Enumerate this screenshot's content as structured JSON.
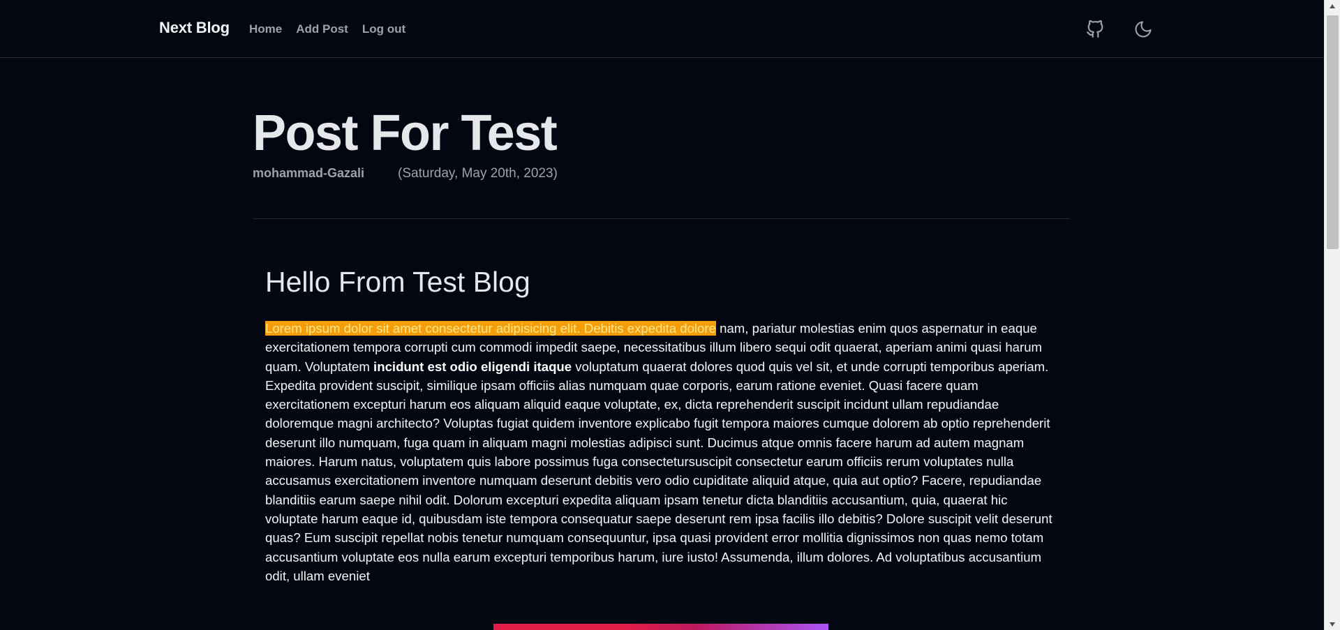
{
  "header": {
    "brand": "Next Blog",
    "nav": [
      {
        "label": "Home"
      },
      {
        "label": "Add Post"
      },
      {
        "label": "Log out"
      }
    ],
    "icons": [
      "github-icon",
      "moon-icon"
    ]
  },
  "post": {
    "title": "Post For Test",
    "author": "mohammad-Gazali",
    "date": "(Saturday, May 20th, 2023)",
    "heading": "Hello From Test Blog",
    "body": {
      "highlighted": "Lorem ipsum dolor sit amet consectetur adipisicing elit. Debitis expedita dolore",
      "part1": " nam, pariatur molestias enim quos aspernatur in eaque exercitationem tempora corrupti cum commodi impedit saepe, necessitatibus illum libero sequi odit quaerat, aperiam animi quasi harum quam. Voluptatem ",
      "bold": "incidunt est odio eligendi itaque",
      "part2": " voluptatum quaerat dolores quod quis vel sit, et unde corrupti temporibus aperiam. Expedita provident suscipit, similique ipsam officiis alias numquam quae corporis, earum ratione eveniet. Quasi facere quam exercitationem excepturi harum eos aliquam aliquid eaque voluptate, ex, dicta reprehenderit suscipit incidunt ullam repudiandae doloremque magni architecto? Voluptas fugiat quidem inventore explicabo fugit tempora maiores cumque dolorem ab optio reprehenderit deserunt illo numquam, fuga quam in aliquam magni molestias adipisci sunt. Ducimus atque omnis facere harum ad autem magnam maiores. Harum natus, voluptatem quis labore possimus fuga consectetursuscipit consectetur earum officiis rerum voluptates nulla accusamus exercitationem inventore numquam deserunt debitis vero odio cupiditate aliquid atque, quia aut optio? Facere, repudiandae blanditiis earum saepe nihil odit. Dolorum excepturi expedita aliquam ipsam tenetur dicta blanditiis accusantium, quia, quaerat hic voluptate harum eaque id, quibusdam iste tempora consequatur saepe deserunt rem ipsa facilis illo debitis? Dolore suscipit velit deserunt quas? Eum suscipit repellat nobis tenetur numquam consequuntur, ipsa quasi provident error mollitia dignissimos non quas nemo totam accusantium voluptate eos nulla earum excepturi temporibus harum, iure iusto! Assumenda, illum dolores. Ad voluptatibus accusantium odit, ullam eveniet"
    }
  },
  "colors": {
    "background": "#030712",
    "highlight": "#f59e0b",
    "muted_text": "#9ca3af"
  }
}
